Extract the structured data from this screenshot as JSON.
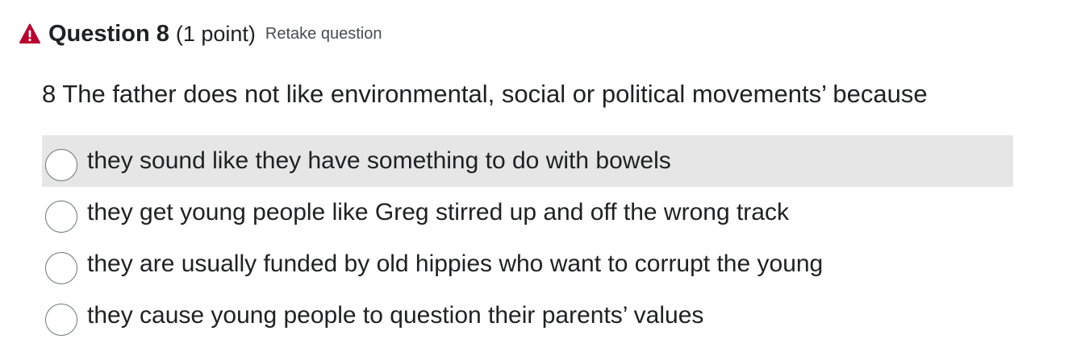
{
  "question": {
    "title": "Question 8",
    "points": "(1 point)",
    "retake_label": "Retake question",
    "prompt": "8 The father does not like environmental, social or political movements’ because",
    "warning_icon": "warning-triangle-icon",
    "warning_color": "#b8002e"
  },
  "options": [
    {
      "label": "they sound like they have something to do with bowels",
      "hovered": true
    },
    {
      "label": "they get young people like Greg stirred up and off the wrong track",
      "hovered": false
    },
    {
      "label": "they are usually funded by old hippies who want to corrupt the young",
      "hovered": false
    },
    {
      "label": "they cause young people to question their parents’ values",
      "hovered": false
    }
  ],
  "colors": {
    "hover_background": "#e6e6e6",
    "text": "#202122",
    "secondary_text": "#494c4e"
  }
}
